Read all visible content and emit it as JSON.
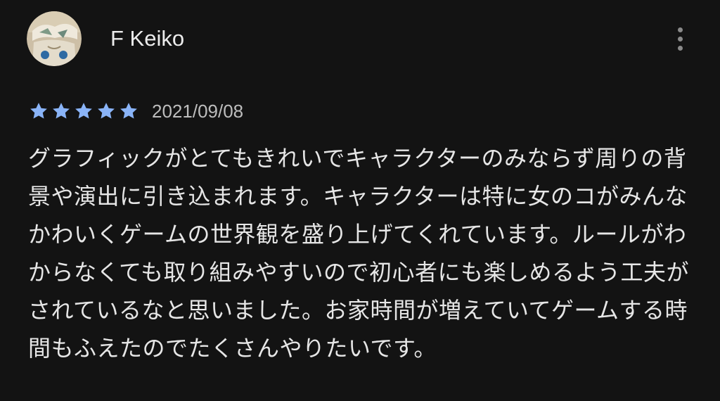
{
  "review": {
    "author": "F Keiko",
    "rating": 5,
    "rating_max": 5,
    "date": "2021/09/08",
    "body": "グラフィックがとてもきれいでキャラクターのみならず周りの背景や演出に引き込まれます。キャラクターは特に女のコがみんなかわいくゲームの世界観を盛り上げてくれています。ルールがわからなくても取り組みやすいので初心者にも楽しめるよう工夫がされているなと思いました。お家時間が増えていてゲームする時間もふえたのでたくさんやりたいです。"
  },
  "icons": {
    "avatar": "avatar-illustration-icon",
    "more": "more-vert-icon",
    "star": "star-filled-icon"
  },
  "colors": {
    "background": "#131313",
    "text": "#e6e6e6",
    "secondary_text": "#bdbdbd",
    "star": "#8ab4f8",
    "menu_dots": "#8a8a8a"
  }
}
